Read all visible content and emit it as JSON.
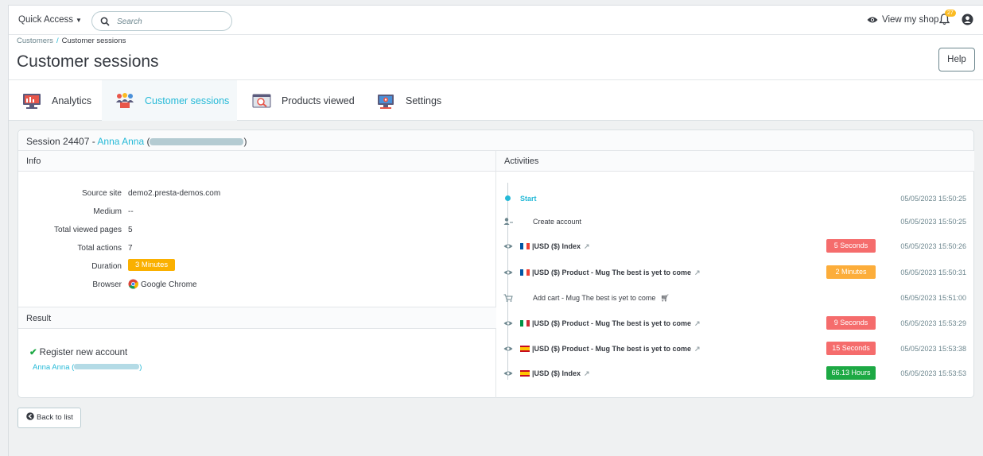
{
  "topbar": {
    "quick_access": "Quick Access",
    "search_placeholder": "Search",
    "view_shop": "View my shop",
    "notification_count": "27"
  },
  "breadcrumb": {
    "parent": "Customers",
    "current": "Customer sessions"
  },
  "page_title": "Customer sessions",
  "help_label": "Help",
  "tabs": [
    {
      "label": "Analytics",
      "icon": "analytics-icon"
    },
    {
      "label": "Customer sessions",
      "icon": "customer-sessions-icon"
    },
    {
      "label": "Products viewed",
      "icon": "products-viewed-icon"
    },
    {
      "label": "Settings",
      "icon": "settings-icon"
    }
  ],
  "session": {
    "prefix": "Session 24407 - ",
    "customer_name": "Anna Anna",
    "open_paren": " (",
    "close_paren": ")"
  },
  "info": {
    "heading": "Info",
    "rows": [
      {
        "label": "Source site",
        "value": "demo2.presta-demos.com"
      },
      {
        "label": "Medium",
        "value": "--"
      },
      {
        "label": "Total viewed pages",
        "value": "5"
      },
      {
        "label": "Total actions",
        "value": "7"
      },
      {
        "label": "Duration",
        "value": "3 Minutes"
      },
      {
        "label": "Browser",
        "value": "Google Chrome"
      }
    ]
  },
  "result": {
    "heading": "Result",
    "title": "Register new account",
    "customer_link": "Anna Anna (",
    "customer_link_close": ")"
  },
  "activities": {
    "heading": "Activities",
    "items": [
      {
        "text": "Start",
        "time": "05/05/2023 15:50:25"
      },
      {
        "text": "Create account",
        "time": "05/05/2023 15:50:25"
      },
      {
        "text": "|USD ($) Index",
        "tag": "5 Seconds",
        "time": "05/05/2023 15:50:26"
      },
      {
        "text": "|USD ($) Product - Mug The best is yet to come",
        "tag": "2 Minutes",
        "time": "05/05/2023 15:50:31"
      },
      {
        "text": "Add cart - Mug The best is yet to come",
        "time": "05/05/2023 15:51:00"
      },
      {
        "text": "|USD ($) Product - Mug The best is yet to come",
        "tag": "9 Seconds",
        "time": "05/05/2023 15:53:29"
      },
      {
        "text": "|USD ($) Product - Mug The best is yet to come",
        "tag": "15 Seconds",
        "time": "05/05/2023 15:53:38"
      },
      {
        "text": "|USD ($) Index",
        "tag": "66.13 Hours",
        "time": "05/05/2023 15:53:53"
      }
    ]
  },
  "colors": {
    "accent": "#25b9d7",
    "tag_red": "#f54c3e",
    "tag_orange": "#fab000",
    "tag_green": "#1da944"
  },
  "back_label": "Back to list"
}
